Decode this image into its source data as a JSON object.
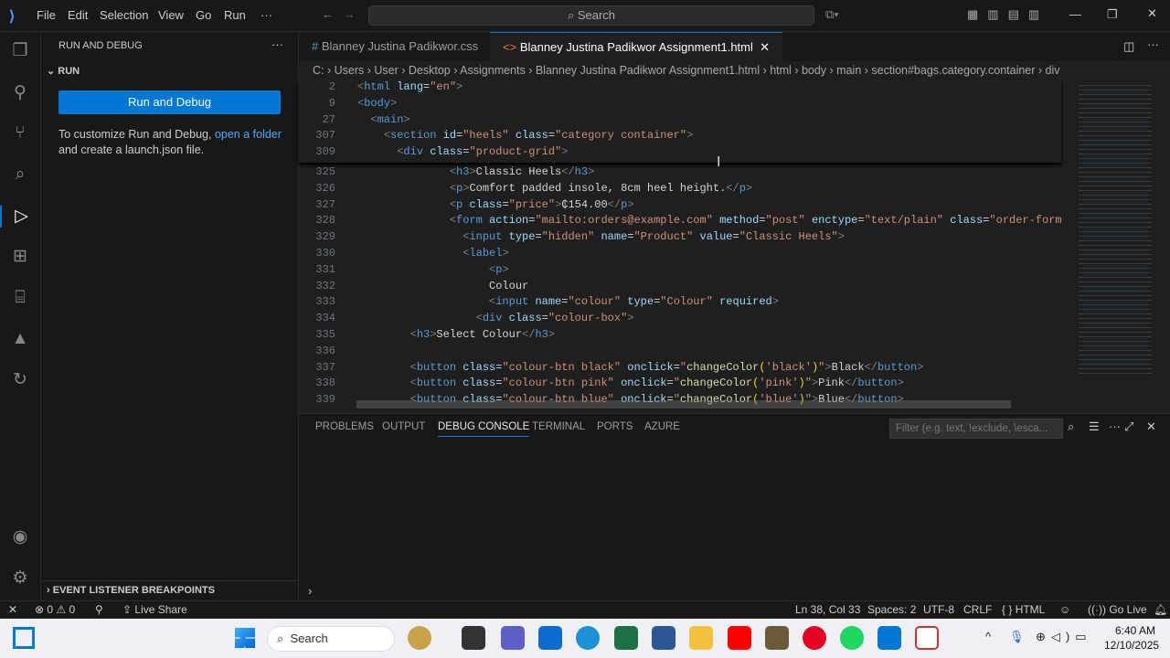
{
  "menu": [
    "File",
    "Edit",
    "Selection",
    "View",
    "Go",
    "Run",
    "···"
  ],
  "search": "Search",
  "sidebar": {
    "title": "RUN AND DEBUG",
    "section": "RUN",
    "button": "Run and Debug",
    "text1": "To customize Run and Debug, ",
    "link": "open a folder",
    "text2": "and create a launch.json file.",
    "footer": "EVENT LISTENER BREAKPOINTS"
  },
  "tabs": [
    {
      "label": "Blanney Justina Padikwor.css",
      "icon": "#"
    },
    {
      "label": "Blanney Justina Padikwor Assignment1.html",
      "icon": "<>"
    }
  ],
  "breadcrumb": [
    "C:",
    "Users",
    "User",
    "Desktop",
    "Assignments",
    "Blanney Justina Padikwor Assignment1.html",
    "html",
    "body",
    "main",
    "section#bags.category.container",
    "div"
  ],
  "sticky": [
    {
      "n": "2",
      "tk": [
        [
          "p",
          "<"
        ],
        [
          "t",
          "html "
        ],
        [
          "a",
          "lang"
        ],
        [
          "x",
          "="
        ],
        [
          "s",
          "\"en\""
        ],
        [
          "p",
          ">"
        ]
      ],
      "i": 0
    },
    {
      "n": "9",
      "tk": [
        [
          "p",
          "<"
        ],
        [
          "t",
          "body"
        ],
        [
          "p",
          ">"
        ]
      ],
      "i": 0
    },
    {
      "n": "27",
      "tk": [
        [
          "p",
          "<"
        ],
        [
          "t",
          "main"
        ],
        [
          "p",
          ">"
        ]
      ],
      "i": 2
    },
    {
      "n": "307",
      "tk": [
        [
          "p",
          "<"
        ],
        [
          "t",
          "section "
        ],
        [
          "a",
          "id"
        ],
        [
          "x",
          "="
        ],
        [
          "s",
          "\"heels\" "
        ],
        [
          "a",
          "class"
        ],
        [
          "x",
          "="
        ],
        [
          "s",
          "\"category container\""
        ],
        [
          "p",
          ">"
        ]
      ],
      "i": 4
    },
    {
      "n": "309",
      "tk": [
        [
          "p",
          "<"
        ],
        [
          "t",
          "div "
        ],
        [
          "a",
          "class"
        ],
        [
          "x",
          "="
        ],
        [
          "s",
          "\"product-grid\""
        ],
        [
          "p",
          ">"
        ]
      ],
      "i": 6
    }
  ],
  "code": [
    {
      "n": "325",
      "i": 14,
      "tk": [
        [
          "p",
          "<"
        ],
        [
          "t",
          "h3"
        ],
        [
          "p",
          ">"
        ],
        [
          "x",
          "Classic Heels"
        ],
        [
          "p",
          "</"
        ],
        [
          "t",
          "h3"
        ],
        [
          "p",
          ">"
        ]
      ]
    },
    {
      "n": "326",
      "i": 14,
      "tk": [
        [
          "p",
          "<"
        ],
        [
          "t",
          "p"
        ],
        [
          "p",
          ">"
        ],
        [
          "x",
          "Comfort padded insole, 8cm heel height."
        ],
        [
          "p",
          "</"
        ],
        [
          "t",
          "p"
        ],
        [
          "p",
          ">"
        ]
      ]
    },
    {
      "n": "327",
      "i": 14,
      "tk": [
        [
          "p",
          "<"
        ],
        [
          "t",
          "p "
        ],
        [
          "a",
          "class"
        ],
        [
          "x",
          "="
        ],
        [
          "s",
          "\"price\""
        ],
        [
          "p",
          ">"
        ],
        [
          "x",
          "₵154.00"
        ],
        [
          "p",
          "</"
        ],
        [
          "t",
          "p"
        ],
        [
          "p",
          ">"
        ]
      ]
    },
    {
      "n": "328",
      "i": 14,
      "tk": [
        [
          "p",
          "<"
        ],
        [
          "t",
          "form "
        ],
        [
          "a",
          "action"
        ],
        [
          "x",
          "="
        ],
        [
          "s",
          "\"mailto:orders@example.com\" "
        ],
        [
          "a",
          "method"
        ],
        [
          "x",
          "="
        ],
        [
          "s",
          "\"post\" "
        ],
        [
          "a",
          "enctype"
        ],
        [
          "x",
          "="
        ],
        [
          "s",
          "\"text/plain\" "
        ],
        [
          "a",
          "class"
        ],
        [
          "x",
          "="
        ],
        [
          "s",
          "\"order-form\""
        ]
      ]
    },
    {
      "n": "329",
      "i": 16,
      "tk": [
        [
          "p",
          "<"
        ],
        [
          "t",
          "input "
        ],
        [
          "a",
          "type"
        ],
        [
          "x",
          "="
        ],
        [
          "s",
          "\"hidden\" "
        ],
        [
          "a",
          "name"
        ],
        [
          "x",
          "="
        ],
        [
          "s",
          "\"Product\" "
        ],
        [
          "a",
          "value"
        ],
        [
          "x",
          "="
        ],
        [
          "s",
          "\"Classic Heels\""
        ],
        [
          "p",
          ">"
        ]
      ]
    },
    {
      "n": "330",
      "i": 16,
      "tk": [
        [
          "p",
          "<"
        ],
        [
          "t",
          "label"
        ],
        [
          "p",
          ">"
        ]
      ]
    },
    {
      "n": "331",
      "i": 20,
      "tk": [
        [
          "p",
          "<"
        ],
        [
          "t",
          "p"
        ],
        [
          "p",
          ">"
        ]
      ]
    },
    {
      "n": "332",
      "i": 20,
      "tk": [
        [
          "x",
          "Colour"
        ]
      ]
    },
    {
      "n": "333",
      "i": 20,
      "tk": [
        [
          "p",
          "<"
        ],
        [
          "t",
          "input "
        ],
        [
          "a",
          "name"
        ],
        [
          "x",
          "="
        ],
        [
          "s",
          "\"colour\" "
        ],
        [
          "a",
          "type"
        ],
        [
          "x",
          "="
        ],
        [
          "s",
          "\"Colour\" "
        ],
        [
          "a",
          "required"
        ],
        [
          "p",
          ">"
        ]
      ]
    },
    {
      "n": "334",
      "i": 18,
      "tk": [
        [
          "p",
          "<"
        ],
        [
          "t",
          "div "
        ],
        [
          "a",
          "class"
        ],
        [
          "x",
          "="
        ],
        [
          "s",
          "\"colour-box\""
        ],
        [
          "p",
          ">"
        ]
      ]
    },
    {
      "n": "335",
      "i": 8,
      "tk": [
        [
          "p",
          "<"
        ],
        [
          "t",
          "h3"
        ],
        [
          "p",
          ">"
        ],
        [
          "x",
          "Select Colour"
        ],
        [
          "p",
          "</"
        ],
        [
          "t",
          "h3"
        ],
        [
          "p",
          ">"
        ]
      ]
    },
    {
      "n": "336",
      "i": 0,
      "tk": []
    },
    {
      "n": "337",
      "i": 8,
      "tk": [
        [
          "p",
          "<"
        ],
        [
          "t",
          "button "
        ],
        [
          "a",
          "class"
        ],
        [
          "x",
          "="
        ],
        [
          "s",
          "\"colour-btn black\" "
        ],
        [
          "a",
          "onclick"
        ],
        [
          "x",
          "="
        ],
        [
          "s",
          "\""
        ],
        [
          "f",
          "changeColor"
        ],
        [
          "y",
          "("
        ],
        [
          "s",
          "'black'"
        ],
        [
          "y",
          ")"
        ],
        [
          "s",
          "\""
        ],
        [
          "p",
          ">"
        ],
        [
          "x",
          "Black"
        ],
        [
          "p",
          "</"
        ],
        [
          "t",
          "button"
        ],
        [
          "p",
          ">"
        ]
      ]
    },
    {
      "n": "338",
      "i": 8,
      "tk": [
        [
          "p",
          "<"
        ],
        [
          "t",
          "button "
        ],
        [
          "a",
          "class"
        ],
        [
          "x",
          "="
        ],
        [
          "s",
          "\"colour-btn pink\" "
        ],
        [
          "a",
          "onclick"
        ],
        [
          "x",
          "="
        ],
        [
          "s",
          "\""
        ],
        [
          "f",
          "changeColor"
        ],
        [
          "y",
          "("
        ],
        [
          "s",
          "'pink'"
        ],
        [
          "y",
          ")"
        ],
        [
          "s",
          "\""
        ],
        [
          "p",
          ">"
        ],
        [
          "x",
          "Pink"
        ],
        [
          "p",
          "</"
        ],
        [
          "t",
          "button"
        ],
        [
          "p",
          ">"
        ]
      ]
    },
    {
      "n": "339",
      "i": 8,
      "tk": [
        [
          "p",
          "<"
        ],
        [
          "t",
          "button "
        ],
        [
          "a",
          "class"
        ],
        [
          "x",
          "="
        ],
        [
          "s",
          "\"colour-btn blue\" "
        ],
        [
          "a",
          "onclick"
        ],
        [
          "x",
          "="
        ],
        [
          "s",
          "\""
        ],
        [
          "f",
          "changeColor"
        ],
        [
          "y",
          "("
        ],
        [
          "s",
          "'blue'"
        ],
        [
          "y",
          ")"
        ],
        [
          "s",
          "\""
        ],
        [
          "p",
          ">"
        ],
        [
          "x",
          "Blue"
        ],
        [
          "p",
          "</"
        ],
        [
          "t",
          "button"
        ],
        [
          "p",
          ">"
        ]
      ]
    }
  ],
  "panel": {
    "tabs": [
      "PROBLEMS",
      "OUTPUT",
      "DEBUG CONSOLE",
      "TERMINAL",
      "PORTS",
      "AZURE"
    ],
    "filter": "Filter (e.g. text, !exclude, \\esca..."
  },
  "status": {
    "errors": "0",
    "warnings": "0",
    "live_share": "Live Share",
    "position": "Ln 38, Col 33",
    "spaces": "Spaces: 2",
    "encoding": "UTF-8",
    "eol": "CRLF",
    "language": "HTML",
    "go_live": "Go Live"
  },
  "taskbar": {
    "search": "Search",
    "time": "6:40 AM",
    "date": "12/10/2025"
  },
  "colors": {
    "accent": "#0078d4"
  }
}
